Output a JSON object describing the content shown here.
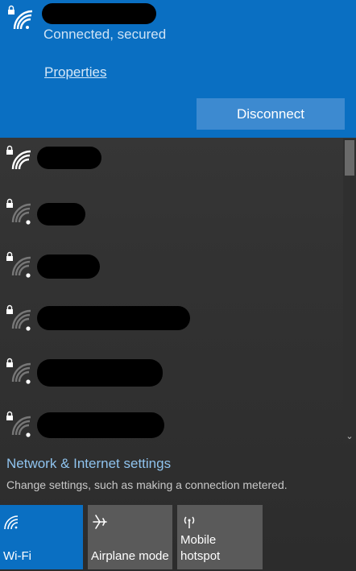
{
  "connected_network": {
    "status": "Connected, secured",
    "properties_label": "Properties",
    "disconnect_label": "Disconnect"
  },
  "networks": [
    {
      "secured": true,
      "signal": "full"
    },
    {
      "secured": true,
      "signal": "weak"
    },
    {
      "secured": true,
      "signal": "weak"
    },
    {
      "secured": true,
      "signal": "weak"
    },
    {
      "secured": true,
      "signal": "weak"
    },
    {
      "secured": true,
      "signal": "weak"
    }
  ],
  "settings": {
    "link_label": "Network & Internet settings",
    "description": "Change settings, such as making a connection metered."
  },
  "quick_actions": {
    "wifi": {
      "label": "Wi-Fi",
      "icon": "wifi-icon",
      "active": true
    },
    "airplane": {
      "label": "Airplane mode",
      "icon": "airplane-icon",
      "active": false
    },
    "hotspot": {
      "label": "Mobile\nhotspot",
      "icon": "hotspot-icon",
      "active": false
    }
  },
  "colors": {
    "accent": "#0a6fc2",
    "link": "#8fc3ee",
    "tile_inactive": "#5a5a5a"
  }
}
